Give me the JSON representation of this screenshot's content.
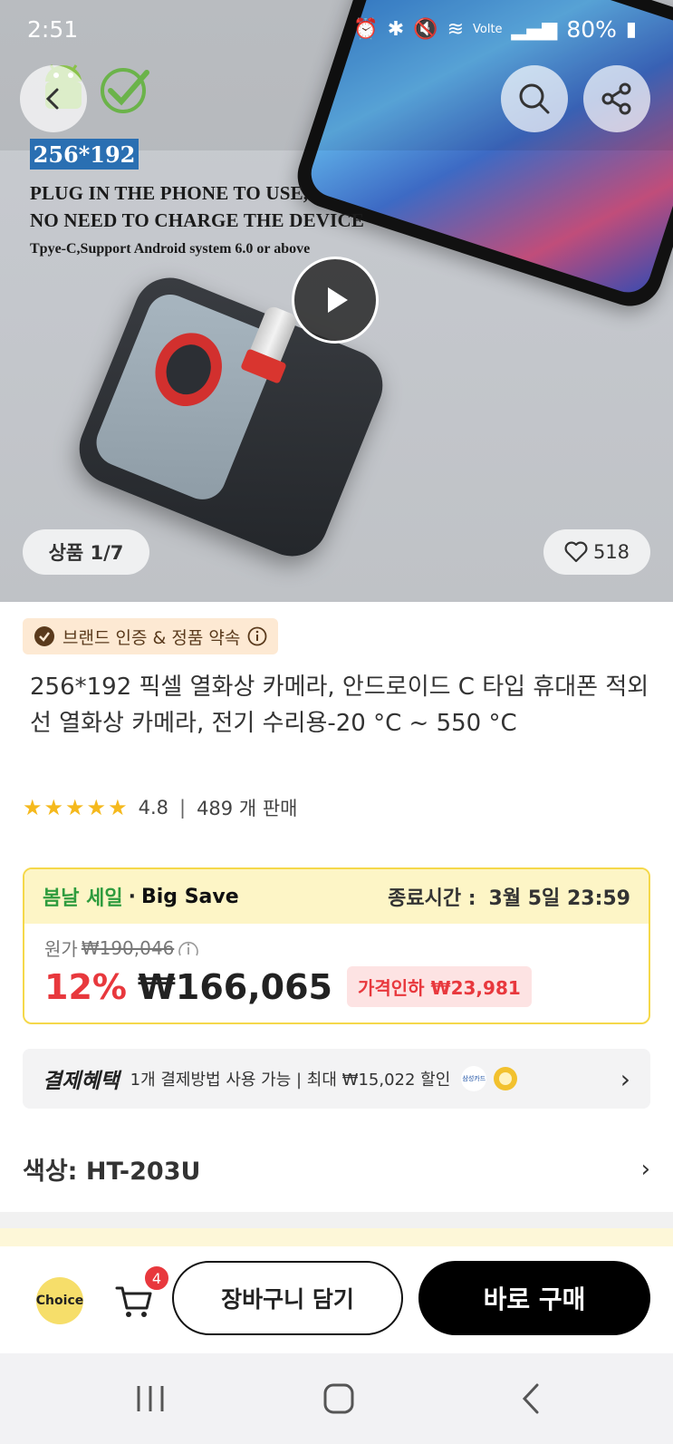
{
  "status_bar": {
    "time": "2:51",
    "battery": "80%",
    "network": "Volte"
  },
  "hero": {
    "resolution_badge": "256*192",
    "headline_line1": "PLUG IN THE PHONE TO USE,",
    "headline_line2": "NO NEED TO CHARGE THE DEVICE",
    "subline": "Tpye-C,Support Android system 6.0 or above",
    "image_counter": "상품 1/7",
    "like_count": "518"
  },
  "product": {
    "brand_badge": "브랜드 인증 & 정품 약속",
    "title": "256*192 픽셀 열화상 카메라, 안드로이드 C 타입 휴대폰 적외선 열화상 카메라, 전기 수리용-20 °C ~ 550 °C",
    "rating": "4.8",
    "sold": "489 개 판매",
    "stars": 5
  },
  "sale": {
    "event_name": "봄날 세일",
    "event_tag": "Big Save",
    "end_label": "종료시간 :",
    "end_time": "3월 5일 23:59",
    "original_label": "원가",
    "original_price": "₩190,046",
    "discount": "12%",
    "price": "₩166,065",
    "price_cut": "가격인하 ₩23,981"
  },
  "payment": {
    "title": "결제혜택",
    "text": "1개 결제방법 사용 가능 | 최대 ₩15,022 할인",
    "card_label": "삼성카드"
  },
  "option": {
    "label": "색상: HT-203U"
  },
  "bottom_bar": {
    "choice_label": "Choice",
    "cart_count": "4",
    "add_to_cart": "장바구니 담기",
    "buy_now": "바로 구매"
  },
  "colors": {
    "accent_red": "#e8383d",
    "sale_green": "#2f9c3e",
    "sale_border": "#f5d84a",
    "star": "#f5b91d"
  }
}
